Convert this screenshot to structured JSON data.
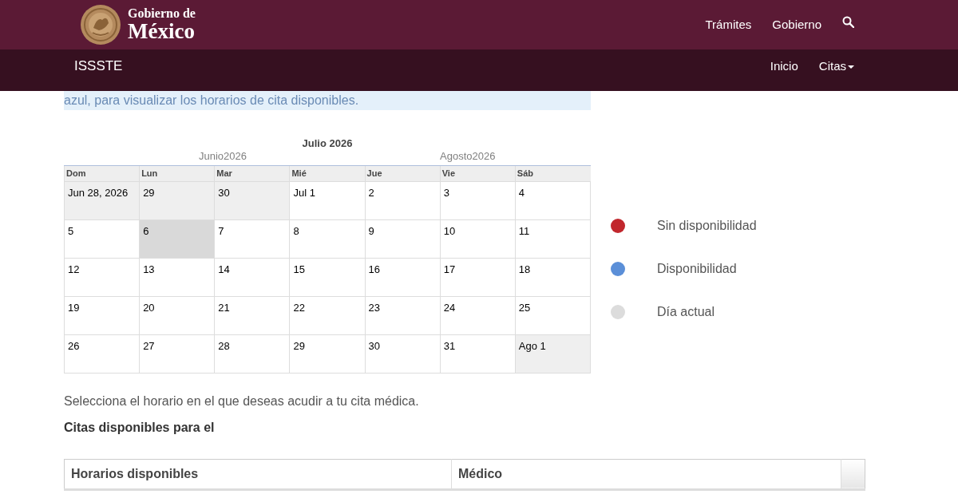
{
  "header": {
    "brand_line_1": "Gobierno de",
    "brand_line_2": "México",
    "links": [
      {
        "label": "Trámites"
      },
      {
        "label": "Gobierno"
      }
    ]
  },
  "subnav": {
    "title": "ISSSTE",
    "links": [
      {
        "label": "Inicio",
        "kind": "link"
      },
      {
        "label": "Citas",
        "kind": "dropdown"
      }
    ]
  },
  "notice": "azul, para visualizar los horarios de cita disponibles.",
  "calendar": {
    "title": "Julio 2026",
    "prev_label": "Junio2026",
    "next_label": "Agosto2026",
    "weekdays": [
      "Dom",
      "Lun",
      "Mar",
      "Mié",
      "Jue",
      "Vie",
      "Sáb"
    ],
    "weeks": [
      [
        {
          "label": "Jun 28, 2026",
          "outside": true,
          "today": false
        },
        {
          "label": "29",
          "outside": true,
          "today": false
        },
        {
          "label": "30",
          "outside": true,
          "today": false
        },
        {
          "label": "Jul 1",
          "outside": false,
          "today": false
        },
        {
          "label": "2",
          "outside": false,
          "today": false
        },
        {
          "label": "3",
          "outside": false,
          "today": false
        },
        {
          "label": "4",
          "outside": false,
          "today": false
        }
      ],
      [
        {
          "label": "5",
          "outside": false,
          "today": false
        },
        {
          "label": "6",
          "outside": false,
          "today": true
        },
        {
          "label": "7",
          "outside": false,
          "today": false
        },
        {
          "label": "8",
          "outside": false,
          "today": false
        },
        {
          "label": "9",
          "outside": false,
          "today": false
        },
        {
          "label": "10",
          "outside": false,
          "today": false
        },
        {
          "label": "11",
          "outside": false,
          "today": false
        }
      ],
      [
        {
          "label": "12",
          "outside": false,
          "today": false
        },
        {
          "label": "13",
          "outside": false,
          "today": false
        },
        {
          "label": "14",
          "outside": false,
          "today": false
        },
        {
          "label": "15",
          "outside": false,
          "today": false
        },
        {
          "label": "16",
          "outside": false,
          "today": false
        },
        {
          "label": "17",
          "outside": false,
          "today": false
        },
        {
          "label": "18",
          "outside": false,
          "today": false
        }
      ],
      [
        {
          "label": "19",
          "outside": false,
          "today": false
        },
        {
          "label": "20",
          "outside": false,
          "today": false
        },
        {
          "label": "21",
          "outside": false,
          "today": false
        },
        {
          "label": "22",
          "outside": false,
          "today": false
        },
        {
          "label": "23",
          "outside": false,
          "today": false
        },
        {
          "label": "24",
          "outside": false,
          "today": false
        },
        {
          "label": "25",
          "outside": false,
          "today": false
        }
      ],
      [
        {
          "label": "26",
          "outside": false,
          "today": false
        },
        {
          "label": "27",
          "outside": false,
          "today": false
        },
        {
          "label": "28",
          "outside": false,
          "today": false
        },
        {
          "label": "29",
          "outside": false,
          "today": false
        },
        {
          "label": "30",
          "outside": false,
          "today": false
        },
        {
          "label": "31",
          "outside": false,
          "today": false
        },
        {
          "label": "Ago 1",
          "outside": true,
          "today": false
        }
      ]
    ]
  },
  "legend": [
    {
      "label": "Sin disponibilidad",
      "color": "#c1272d"
    },
    {
      "label": "Disponibilidad",
      "color": "#5b8fd8"
    },
    {
      "label": "Día actual",
      "color": "#dcdcdc"
    }
  ],
  "instructions": "Selecciona el horario en el que deseas acudir a tu cita médica.",
  "subtitle": "Citas disponibles para el",
  "table": {
    "columns": [
      "Horarios disponibles",
      "Médico"
    ]
  }
}
